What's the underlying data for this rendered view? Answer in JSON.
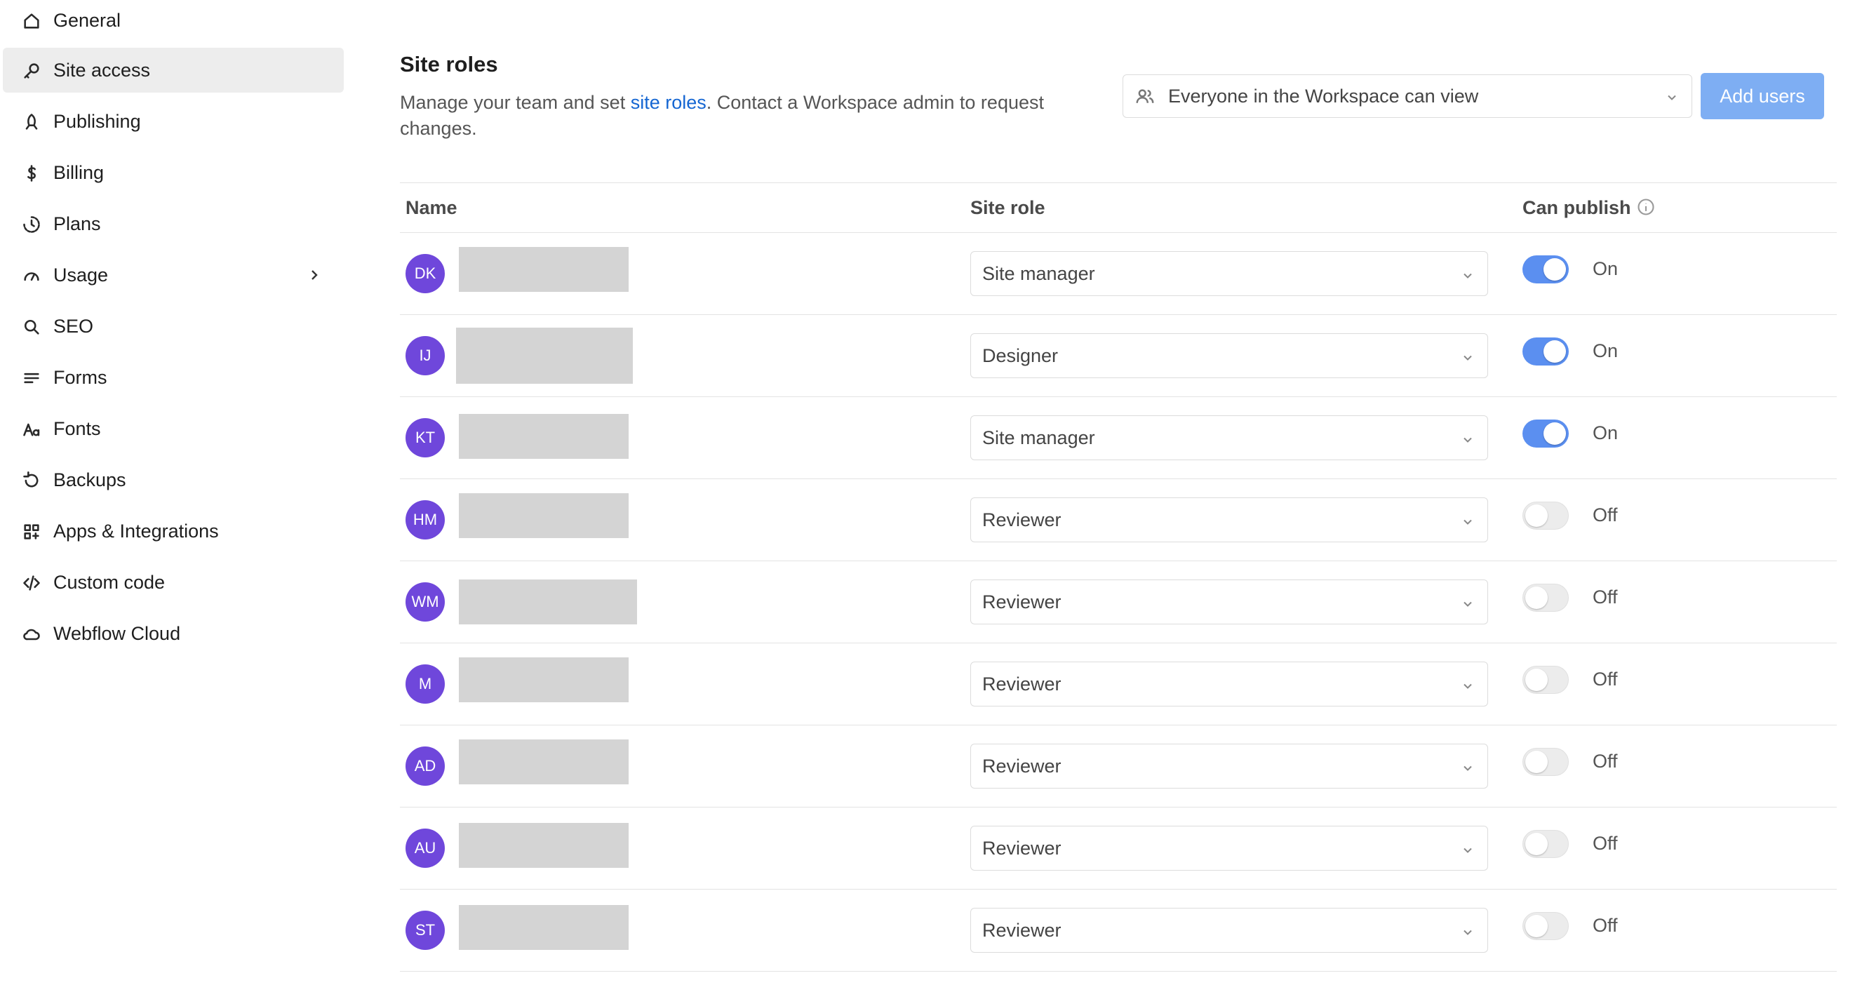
{
  "sidebar": {
    "items": [
      {
        "label": "General",
        "icon": "home-icon",
        "active": false
      },
      {
        "label": "Site access",
        "icon": "key-icon",
        "active": true
      },
      {
        "label": "Publishing",
        "icon": "rocket-icon",
        "active": false
      },
      {
        "label": "Billing",
        "icon": "dollar-icon",
        "active": false
      },
      {
        "label": "Plans",
        "icon": "plans-icon",
        "active": false
      },
      {
        "label": "Usage",
        "icon": "gauge-icon",
        "active": false,
        "has_submenu": true
      },
      {
        "label": "SEO",
        "icon": "search-icon",
        "active": false
      },
      {
        "label": "Forms",
        "icon": "forms-icon",
        "active": false
      },
      {
        "label": "Fonts",
        "icon": "fonts-icon",
        "active": false
      },
      {
        "label": "Backups",
        "icon": "restore-icon",
        "active": false
      },
      {
        "label": "Apps & Integrations",
        "icon": "apps-icon",
        "active": false
      },
      {
        "label": "Custom code",
        "icon": "code-icon",
        "active": false
      },
      {
        "label": "Webflow Cloud",
        "icon": "cloud-icon",
        "active": false
      }
    ]
  },
  "main": {
    "title": "Site roles",
    "description_before": "Manage your team and set ",
    "description_link": "site roles",
    "description_after": ". Contact a Workspace admin to request changes.",
    "visibility_select": "Everyone in the Workspace can view",
    "add_users_label": "Add users"
  },
  "table": {
    "headers": {
      "name": "Name",
      "site_role": "Site role",
      "can_publish": "Can publish"
    },
    "rows": [
      {
        "initials": "DK",
        "role": "Site manager",
        "can_publish": true,
        "publish_label": "On"
      },
      {
        "initials": "IJ",
        "role": "Designer",
        "can_publish": true,
        "publish_label": "On"
      },
      {
        "initials": "KT",
        "role": "Site manager",
        "can_publish": true,
        "publish_label": "On"
      },
      {
        "initials": "HM",
        "role": "Reviewer",
        "can_publish": false,
        "publish_label": "Off"
      },
      {
        "initials": "WM",
        "role": "Reviewer",
        "can_publish": false,
        "publish_label": "Off"
      },
      {
        "initials": "M",
        "role": "Reviewer",
        "can_publish": false,
        "publish_label": "Off"
      },
      {
        "initials": "AD",
        "role": "Reviewer",
        "can_publish": false,
        "publish_label": "Off"
      },
      {
        "initials": "AU",
        "role": "Reviewer",
        "can_publish": false,
        "publish_label": "Off"
      },
      {
        "initials": "ST",
        "role": "Reviewer",
        "can_publish": false,
        "publish_label": "Off"
      }
    ]
  },
  "colors": {
    "accent": "#5b8ff0",
    "avatar": "#6f47db",
    "link": "#1566d2",
    "button": "#7eaef3"
  }
}
